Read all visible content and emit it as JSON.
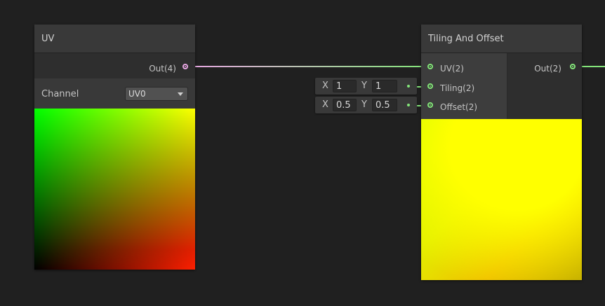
{
  "uv_node": {
    "title": "UV",
    "out_label": "Out(4)",
    "channel_label": "Channel",
    "channel_value": "UV0",
    "preview_colors": {
      "top_left": "#00ff00",
      "top_right": "#ffff00",
      "bottom_left": "#000000",
      "bottom_right": "#ff0000"
    }
  },
  "tiling_node": {
    "title": "Tiling And Offset",
    "inputs": [
      {
        "label": "UV(2)"
      },
      {
        "label": "Tiling(2)"
      },
      {
        "label": "Offset(2)"
      }
    ],
    "out_label": "Out(2)"
  },
  "tiling_input": {
    "x_label": "X",
    "x": "1",
    "y_label": "Y",
    "y": "1"
  },
  "offset_input": {
    "x_label": "X",
    "x": "0.5",
    "y_label": "Y",
    "y": "0.5"
  },
  "colors": {
    "vector4_port": "#e7a6e2",
    "vector2_port": "#84e57a",
    "background": "#202020",
    "node": "#393939"
  }
}
